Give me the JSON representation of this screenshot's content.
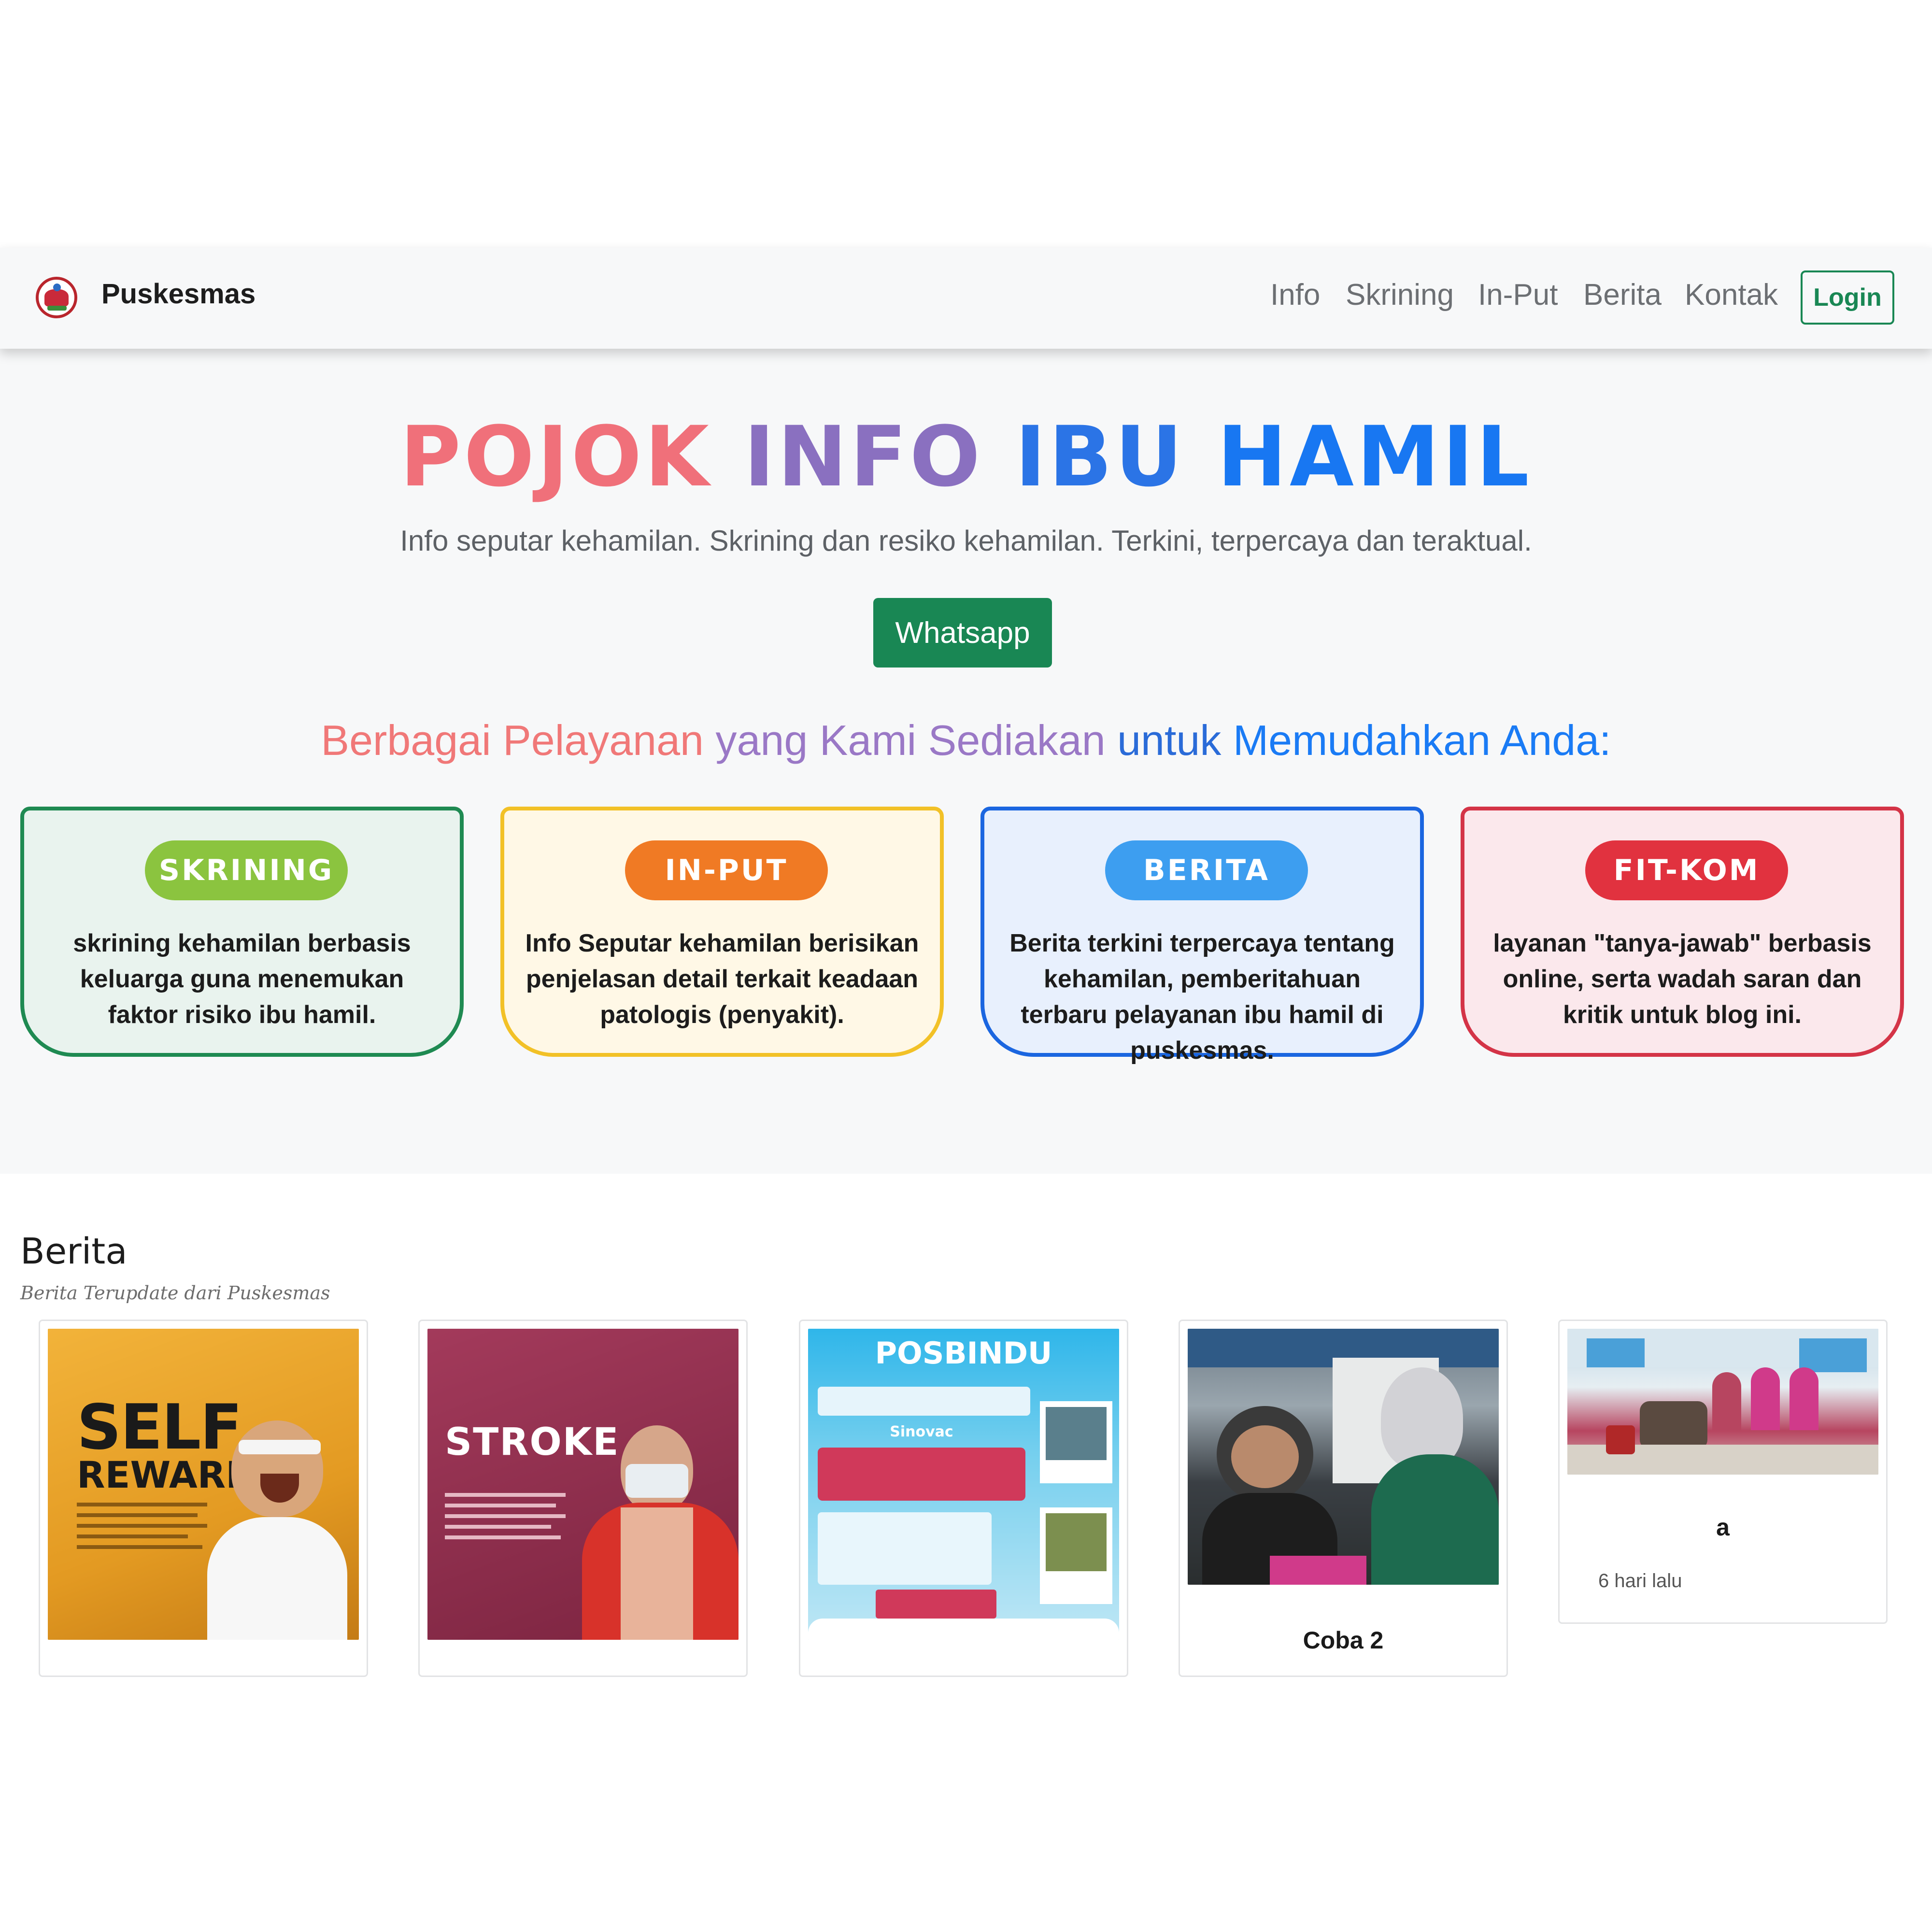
{
  "navbar": {
    "brand": "Puskesmas",
    "links": [
      "Info",
      "Skrining",
      "In-Put",
      "Berita",
      "Kontak"
    ],
    "login": "Login"
  },
  "hero": {
    "title_words": [
      "POJOK",
      "INFO",
      "IBU",
      "HAMIL"
    ],
    "subtitle": "Info seputar kehamilan. Skrining dan resiko kehamilan. Terkini, terpercaya dan teraktual.",
    "whatsapp": "Whatsapp",
    "services_heading_parts": [
      "Berbagai Pelayanan",
      "yang",
      "Kami Sediakan",
      "untuk",
      "Memudahkan Anda:"
    ]
  },
  "services": [
    {
      "label": "SKRINING",
      "text": "skrining kehamilan berbasis keluarga guna menemukan faktor risiko ibu hamil."
    },
    {
      "label": "IN-PUT",
      "text": "Info Seputar kehamilan berisikan penjelasan detail terkait keadaan patologis (penyakit)."
    },
    {
      "label": "BERITA",
      "text": "Berita terkini terpercaya tentang kehamilan, pemberitahuan terbaru pelayanan ibu hamil di puskesmas."
    },
    {
      "label": "FIT-KOM",
      "text": "layanan \"tanya-jawab\" berbasis online, serta wadah saran dan kritik untuk blog ini."
    }
  ],
  "news": {
    "title": "Berita",
    "subtitle": "Berita Terupdate dari Puskesmas",
    "items": [
      {
        "image_text_1": "SELF",
        "image_text_2": "REWARD",
        "caption": ""
      },
      {
        "image_text_1": "STROKE",
        "caption": ""
      },
      {
        "image_text_1": "POSBINDU",
        "image_text_2": "Sinovac",
        "caption": ""
      },
      {
        "caption": "Coba 2"
      },
      {
        "caption": "a",
        "time": "6 hari lalu"
      }
    ]
  },
  "colors": {
    "primary_green": "#198754",
    "accent_blue": "#1877f2",
    "accent_pink": "#f0707a"
  }
}
